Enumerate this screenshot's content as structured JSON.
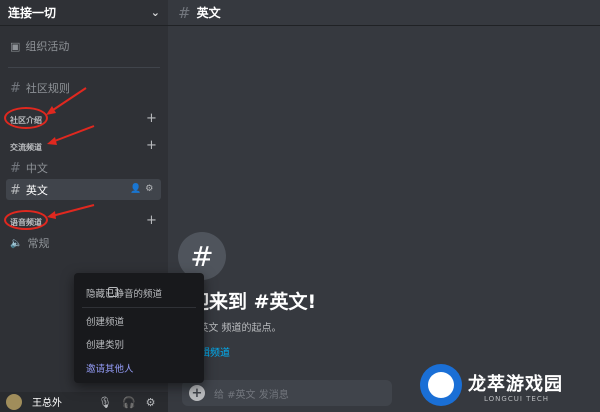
{
  "server": {
    "name": "连接一切"
  },
  "sidebar": {
    "events_label": "组织活动",
    "rules_channel": "社区规则",
    "categories": [
      "社区介绍",
      "交流频道",
      "语音频道"
    ],
    "channels": [
      "中文",
      "英文"
    ],
    "voice_channel": "常规"
  },
  "user": {
    "name": "王总外"
  },
  "main": {
    "channel_title": "英文",
    "welcome": "迎来到 #英文!",
    "start_text": "#英文 频道的起点。",
    "edit_text": "编辑频道",
    "message_placeholder": "给 #英文 发消息"
  },
  "context_menu": {
    "items": [
      "隐藏已静音的频道",
      "创建频道",
      "创建类别",
      "邀请其他人"
    ]
  },
  "watermark": {
    "title": "龙萃游戏园",
    "subtitle": "LONGCUI TECH"
  },
  "colors": {
    "sidebar": "#2f3136",
    "main": "#36393f",
    "annotation": "#e0281f",
    "link": "#00aff4"
  }
}
